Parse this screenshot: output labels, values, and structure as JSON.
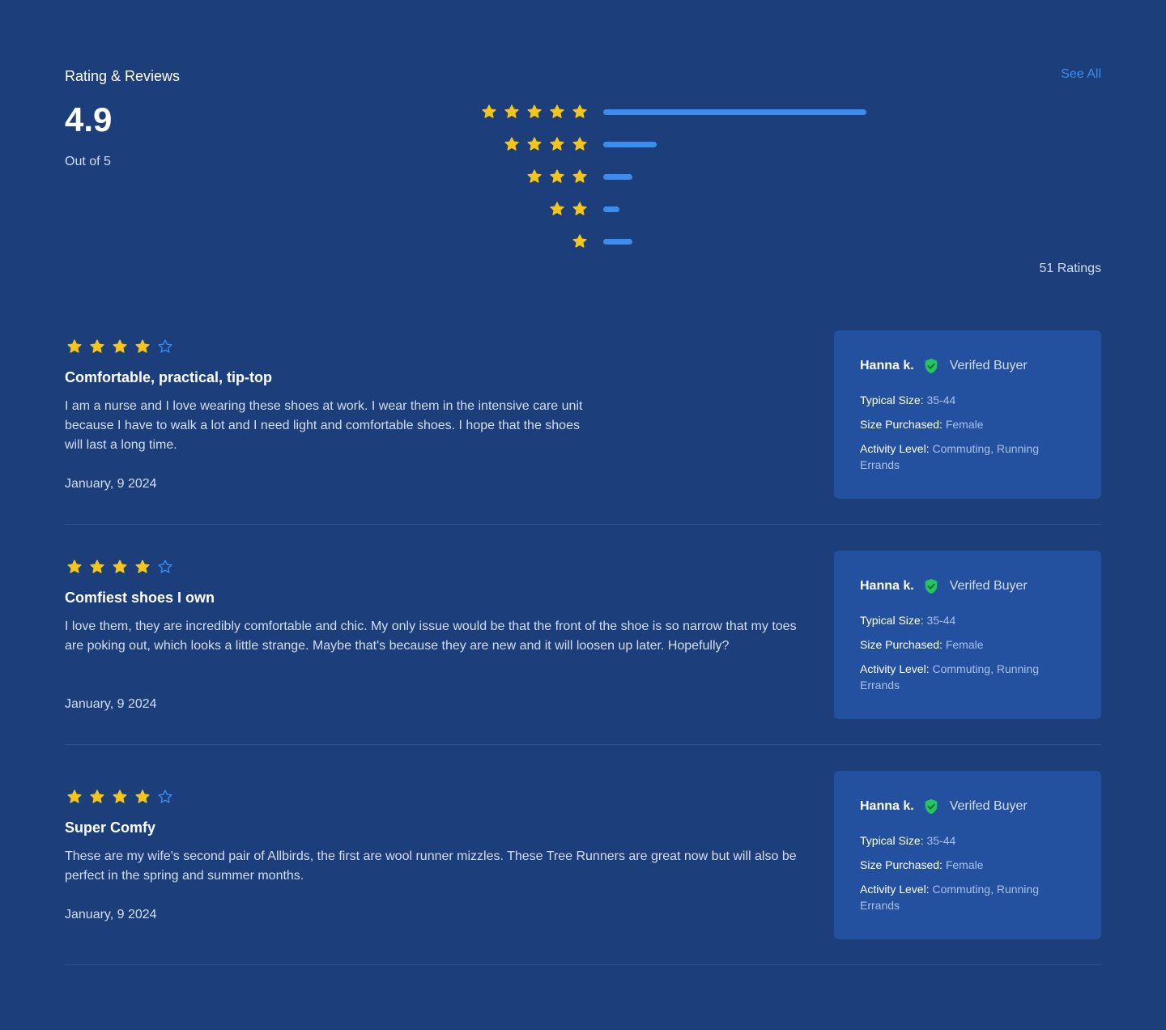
{
  "header": {
    "title": "Rating & Reviews",
    "see_all": "See All"
  },
  "summary": {
    "average": "4.9",
    "out_of": "Out of 5",
    "ratings_count": "51 Ratings"
  },
  "distribution": [
    {
      "stars": 5,
      "fraction": 0.985
    },
    {
      "stars": 4,
      "fraction": 0.2
    },
    {
      "stars": 3,
      "fraction": 0.11
    },
    {
      "stars": 2,
      "fraction": 0.06
    },
    {
      "stars": 1,
      "fraction": 0.11
    }
  ],
  "colors": {
    "background": "#1c3f7c",
    "accent": "#3b8eef",
    "star": "#f5c518",
    "card": "#2351a0",
    "verified_green": "#22c55e"
  },
  "reviews": [
    {
      "rating": 4,
      "title": "Comfortable, practical, tip-top",
      "body": "I am a nurse and I love wearing these shoes at work. I wear them in the intensive care unit because I have to walk a lot and I need light and comfortable shoes. I hope that the shoes will last a long time.",
      "date": "January, 9 2024",
      "buyer": {
        "name": "Hanna k.",
        "verified_label": "Verifed Buyer",
        "typical_size_label": "Typical Size:",
        "typical_size": "35-44",
        "size_purchased_label": "Size Purchased:",
        "size_purchased": "Female",
        "activity_label": "Activity Level:",
        "activity": "Commuting, Running Errands"
      }
    },
    {
      "rating": 4,
      "title": "Comfiest shoes I own",
      "body": "I love them, they are incredibly comfortable and chic. My only issue would be that the front of the shoe is so narrow that my toes are poking out, which looks a little strange. Maybe that's because they are new and it will loosen up later. Hopefully?",
      "date": "January, 9 2024",
      "buyer": {
        "name": "Hanna k.",
        "verified_label": "Verifed Buyer",
        "typical_size_label": "Typical Size:",
        "typical_size": "35-44",
        "size_purchased_label": "Size Purchased:",
        "size_purchased": "Female",
        "activity_label": "Activity Level:",
        "activity": "Commuting, Running Errands"
      }
    },
    {
      "rating": 4,
      "title": "Super Comfy",
      "body": "These are my wife's second pair of Allbirds, the first are wool runner mizzles. These Tree Runners are great now but will also be perfect in the spring and summer months.",
      "date": "January, 9 2024",
      "buyer": {
        "name": "Hanna k.",
        "verified_label": "Verifed Buyer",
        "typical_size_label": "Typical Size:",
        "typical_size": "35-44",
        "size_purchased_label": "Size Purchased:",
        "size_purchased": "Female",
        "activity_label": "Activity Level:",
        "activity": "Commuting, Running Errands"
      }
    }
  ]
}
